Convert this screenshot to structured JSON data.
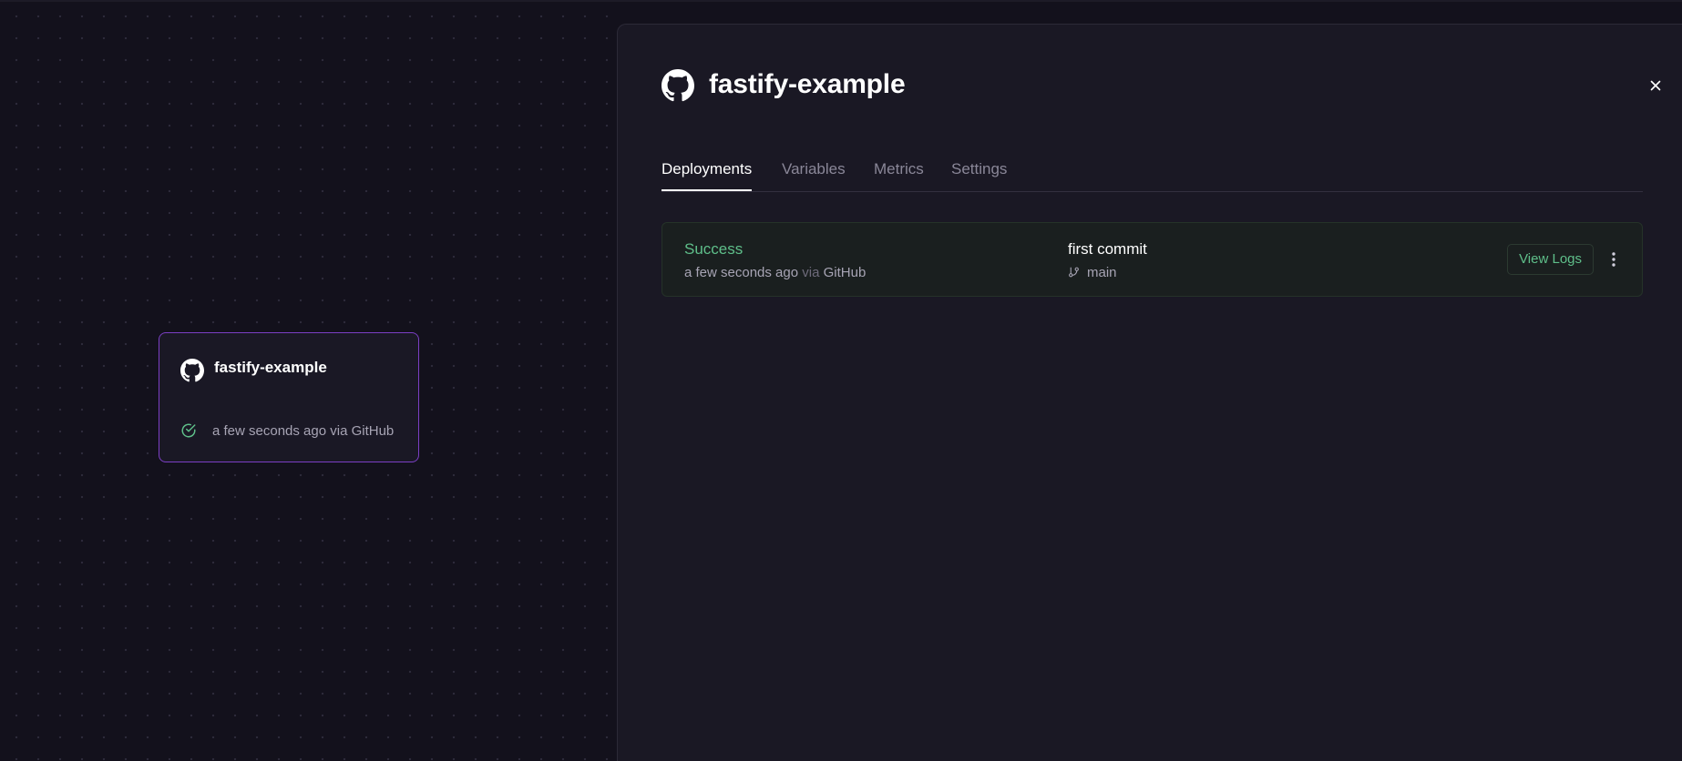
{
  "node": {
    "title": "fastify-example",
    "meta": "a few seconds ago via GitHub",
    "icon": "github-icon",
    "status_icon": "check-circle-icon"
  },
  "panel": {
    "title": "fastify-example",
    "icon": "github-icon",
    "close_icon": "close-icon",
    "tabs": [
      {
        "label": "Deployments",
        "active": true
      },
      {
        "label": "Variables",
        "active": false
      },
      {
        "label": "Metrics",
        "active": false
      },
      {
        "label": "Settings",
        "active": false
      }
    ],
    "deployment": {
      "status": "Success",
      "time": "a few seconds ago",
      "via": "via",
      "source": "GitHub",
      "commit": "first commit",
      "branch": "main",
      "branch_icon": "git-branch-icon",
      "view_logs": "View Logs",
      "menu_icon": "more-vertical-icon"
    }
  },
  "colors": {
    "accent_success": "#5fbf8a",
    "node_border": "#7b3fc4",
    "background": "#13111c",
    "panel_bg": "#1a1824"
  }
}
